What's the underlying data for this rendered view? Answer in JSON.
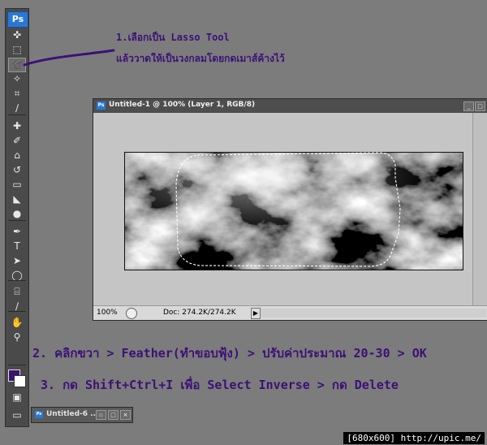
{
  "app": {
    "logo": "Ps"
  },
  "toolbox": {
    "tools": [
      {
        "name": "move-tool",
        "glyph": "✜"
      },
      {
        "name": "marquee-tool",
        "glyph": "⬚"
      },
      {
        "name": "lasso-tool",
        "glyph": "➰",
        "selected": true
      },
      {
        "name": "quick-selection-tool",
        "glyph": "✧"
      },
      {
        "name": "crop-tool",
        "glyph": "⌗"
      },
      {
        "name": "eyedropper-tool",
        "glyph": "∕"
      },
      {
        "name": "healing-brush-tool",
        "glyph": "✚"
      },
      {
        "name": "brush-tool",
        "glyph": "✐"
      },
      {
        "name": "clone-stamp-tool",
        "glyph": "⌂"
      },
      {
        "name": "history-brush-tool",
        "glyph": "↺"
      },
      {
        "name": "eraser-tool",
        "glyph": "▭"
      },
      {
        "name": "paint-bucket-tool",
        "glyph": "◣"
      },
      {
        "name": "dodge-tool",
        "glyph": "●"
      },
      {
        "name": "pen-tool",
        "glyph": "✒"
      },
      {
        "name": "type-tool",
        "glyph": "T"
      },
      {
        "name": "path-selection-tool",
        "glyph": "➤"
      },
      {
        "name": "ellipse-tool",
        "glyph": "◯"
      },
      {
        "name": "notes-tool",
        "glyph": "⌸"
      },
      {
        "name": "eyedropper-tool-2",
        "glyph": "∕"
      },
      {
        "name": "hand-tool",
        "glyph": "✋"
      },
      {
        "name": "zoom-tool",
        "glyph": "⚲"
      }
    ],
    "foreground_color": "#3a1470",
    "background_color": "#ffffff"
  },
  "annotations": {
    "step1_line1": "1.เลือกเป็น Lasso Tool",
    "step1_line2": "แล้ววาดให้เป็นวงกลมโดยกดเมาส์ค้างไว้",
    "step2": "2. คลิกขวา > Feather(ทำขอบฟุ้ง) > ปรับค่าประมาณ 20-30 > OK",
    "step3": "3. กด Shift+Ctrl+I เพื่อ Select Inverse > กด Delete",
    "text_color": "#3b1177"
  },
  "document": {
    "title": "Untitled-1 @ 100% (Layer 1, RGB/8)",
    "zoom": "100%",
    "doc_size": "Doc: 274.2K/274.2K",
    "status_arrow": "▶",
    "min_button": "_",
    "close_button": "□"
  },
  "minimized_window": {
    "title": "Untitled-6 ...",
    "button_restore": "▫",
    "button_maximize": "□",
    "button_close": "×"
  },
  "watermark": "[680x600] http://upic.me/"
}
